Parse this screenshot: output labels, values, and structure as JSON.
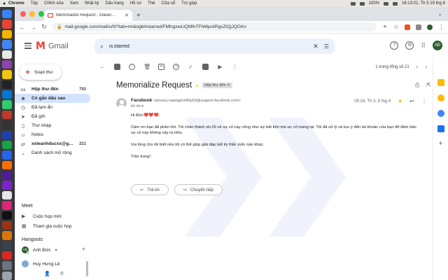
{
  "menubar": {
    "app": "Chrome",
    "items": [
      "Tệp",
      "Chỉnh sửa",
      "Xem",
      "Nhật ký",
      "Dấu trang",
      "Hồ sơ",
      "Thẻ",
      "Cửa sổ",
      "Trợ giúp"
    ],
    "battery": "100%",
    "clock": "16:13:01, Th 5 19 thg 8"
  },
  "browser": {
    "tab_title": "Memorialize Request - zxlean…",
    "new_tab": "+",
    "url": "mail.google.com/mail/u/0/?tab=rm&ogbl#starred/FMfcgxwLtQMfnTFhMpckRgsZtQjJQGKn"
  },
  "gmail": {
    "brand": "Gmail",
    "search_query": "is:starred",
    "compose": "Soạn thư",
    "nav": [
      {
        "icon": "inbox",
        "label": "Hộp thư đến",
        "count": "793",
        "bold": true
      },
      {
        "icon": "star",
        "label": "Có gắn dấu sao",
        "count": "",
        "active": true
      },
      {
        "icon": "clock",
        "label": "Đã tạm ẩn",
        "count": ""
      },
      {
        "icon": "send",
        "label": "Đã gửi",
        "count": ""
      },
      {
        "icon": "file",
        "label": "Thư nháp",
        "count": ""
      },
      {
        "icon": "file",
        "label": "Notes",
        "count": ""
      },
      {
        "icon": "label",
        "label": "xxleanhducxx@g…",
        "count": "321",
        "bold": true
      },
      {
        "icon": "chevron-down",
        "label": "Danh sách mở rộng",
        "count": ""
      }
    ],
    "meet": {
      "title": "Meet",
      "new_meeting": "Cuộc họp mới",
      "join_meeting": "Tham gia cuộc họp"
    },
    "hangouts": {
      "title": "Hangouts",
      "me": "Anh Đức",
      "me_initials": "AĐ",
      "contact": "Huy Hưng Lê"
    },
    "pager": "1 trong tổng số 21",
    "email": {
      "subject": "Memorialize Request",
      "label": "Hộp thư đến",
      "sender_name": "Facebook",
      "sender_email": "<privacy+aaeqgmi46tp63@support.facebook.com>",
      "to": "tới tôi",
      "date": "05:24, Th 3, 6 thg 4",
      "greeting": "Hi Đức❤️❤️❤️,",
      "paragraph1": "Cảm ơn bạn đã phản hồi. Tôi chân thành xin lỗi về sự cố này cũng như sự bất tiện mà sự cố mang lại. Tôi đã xử lý và lưu ý đến tài khoản của bạn để đảm bảo sự cố này không xảy ra nữa.",
      "paragraph2": "Vui lòng cho tôi biết nếu tôi có thể giúp giải đáp bất kỳ thắc mắc nào khác.",
      "signoff": "Trân trọng!",
      "reply": "Trả lời",
      "forward": "Chuyển tiếp"
    }
  },
  "colors": {
    "gmail_red": "#ea4335",
    "active_nav": "#d3e3fd",
    "search_bg": "#eaf1fb",
    "star": "#f4b400"
  }
}
